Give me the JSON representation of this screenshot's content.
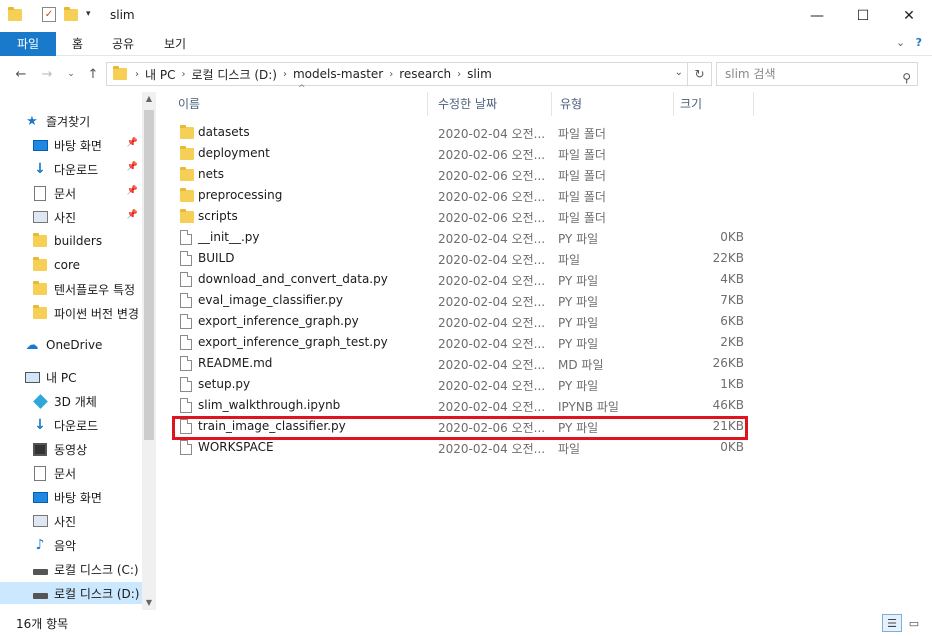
{
  "window": {
    "title": "slim"
  },
  "ribbon": {
    "tabs": [
      "파일",
      "홈",
      "공유",
      "보기"
    ]
  },
  "address": {
    "crumbs": [
      "내 PC",
      "로컬 디스크 (D:)",
      "models-master",
      "research",
      "slim"
    ],
    "search_placeholder": "slim 검색"
  },
  "sidebar": {
    "items": [
      {
        "label": "즐겨찾기",
        "icon": "star-icon",
        "pinned": false,
        "indent": 0
      },
      {
        "label": "바탕 화면",
        "icon": "desktop-icon",
        "pinned": true,
        "indent": 1
      },
      {
        "label": "다운로드",
        "icon": "download-icon",
        "pinned": true,
        "indent": 1
      },
      {
        "label": "문서",
        "icon": "document-icon",
        "pinned": true,
        "indent": 1
      },
      {
        "label": "사진",
        "icon": "pictures-icon",
        "pinned": true,
        "indent": 1
      },
      {
        "label": "builders",
        "icon": "folder-icon",
        "pinned": false,
        "indent": 1
      },
      {
        "label": "core",
        "icon": "folder-icon",
        "pinned": false,
        "indent": 1
      },
      {
        "label": "텐서플로우 특정",
        "icon": "folder-icon",
        "pinned": false,
        "indent": 1
      },
      {
        "label": "파이썬 버전 변경",
        "icon": "folder-icon",
        "pinned": false,
        "indent": 1
      },
      {
        "label": "OneDrive",
        "icon": "cloud-icon",
        "pinned": false,
        "indent": 0
      },
      {
        "label": "내 PC",
        "icon": "pc-icon",
        "pinned": false,
        "indent": 0
      },
      {
        "label": "3D 개체",
        "icon": "cube-icon",
        "pinned": false,
        "indent": 1
      },
      {
        "label": "다운로드",
        "icon": "download-icon",
        "pinned": false,
        "indent": 1
      },
      {
        "label": "동영상",
        "icon": "video-icon",
        "pinned": false,
        "indent": 1
      },
      {
        "label": "문서",
        "icon": "document-icon",
        "pinned": false,
        "indent": 1
      },
      {
        "label": "바탕 화면",
        "icon": "desktop-icon",
        "pinned": false,
        "indent": 1
      },
      {
        "label": "사진",
        "icon": "pictures-icon",
        "pinned": false,
        "indent": 1
      },
      {
        "label": "음악",
        "icon": "music-icon",
        "pinned": false,
        "indent": 1
      },
      {
        "label": "로컬 디스크 (C:)",
        "icon": "drive-icon",
        "pinned": false,
        "indent": 1
      },
      {
        "label": "로컬 디스크 (D:)",
        "icon": "drive-icon",
        "pinned": false,
        "indent": 1,
        "selected": true
      }
    ]
  },
  "columns": {
    "name": "이름",
    "date": "수정한 날짜",
    "type": "유형",
    "size": "크기"
  },
  "files": [
    {
      "name": "datasets",
      "date": "2020-02-04 오전...",
      "type": "파일 폴더",
      "size": "",
      "kind": "folder"
    },
    {
      "name": "deployment",
      "date": "2020-02-06 오전...",
      "type": "파일 폴더",
      "size": "",
      "kind": "folder"
    },
    {
      "name": "nets",
      "date": "2020-02-06 오전...",
      "type": "파일 폴더",
      "size": "",
      "kind": "folder"
    },
    {
      "name": "preprocessing",
      "date": "2020-02-06 오전...",
      "type": "파일 폴더",
      "size": "",
      "kind": "folder"
    },
    {
      "name": "scripts",
      "date": "2020-02-06 오전...",
      "type": "파일 폴더",
      "size": "",
      "kind": "folder"
    },
    {
      "name": "__init__.py",
      "date": "2020-02-04 오전...",
      "type": "PY 파일",
      "size": "0KB",
      "kind": "file"
    },
    {
      "name": "BUILD",
      "date": "2020-02-04 오전...",
      "type": "파일",
      "size": "22KB",
      "kind": "file"
    },
    {
      "name": "download_and_convert_data.py",
      "date": "2020-02-04 오전...",
      "type": "PY 파일",
      "size": "4KB",
      "kind": "file"
    },
    {
      "name": "eval_image_classifier.py",
      "date": "2020-02-04 오전...",
      "type": "PY 파일",
      "size": "7KB",
      "kind": "file"
    },
    {
      "name": "export_inference_graph.py",
      "date": "2020-02-04 오전...",
      "type": "PY 파일",
      "size": "6KB",
      "kind": "file"
    },
    {
      "name": "export_inference_graph_test.py",
      "date": "2020-02-04 오전...",
      "type": "PY 파일",
      "size": "2KB",
      "kind": "file"
    },
    {
      "name": "README.md",
      "date": "2020-02-04 오전...",
      "type": "MD 파일",
      "size": "26KB",
      "kind": "file"
    },
    {
      "name": "setup.py",
      "date": "2020-02-04 오전...",
      "type": "PY 파일",
      "size": "1KB",
      "kind": "file"
    },
    {
      "name": "slim_walkthrough.ipynb",
      "date": "2020-02-04 오전...",
      "type": "IPYNB 파일",
      "size": "46KB",
      "kind": "file"
    },
    {
      "name": "train_image_classifier.py",
      "date": "2020-02-06 오전...",
      "type": "PY 파일",
      "size": "21KB",
      "kind": "file",
      "highlighted": true
    },
    {
      "name": "WORKSPACE",
      "date": "2020-02-04 오전...",
      "type": "파일",
      "size": "0KB",
      "kind": "file"
    }
  ],
  "status": {
    "count_text": "16개 항목"
  },
  "colors": {
    "accent": "#1979ca",
    "highlight_border": "#e0141e",
    "selected_bg": "#cce8ff"
  }
}
